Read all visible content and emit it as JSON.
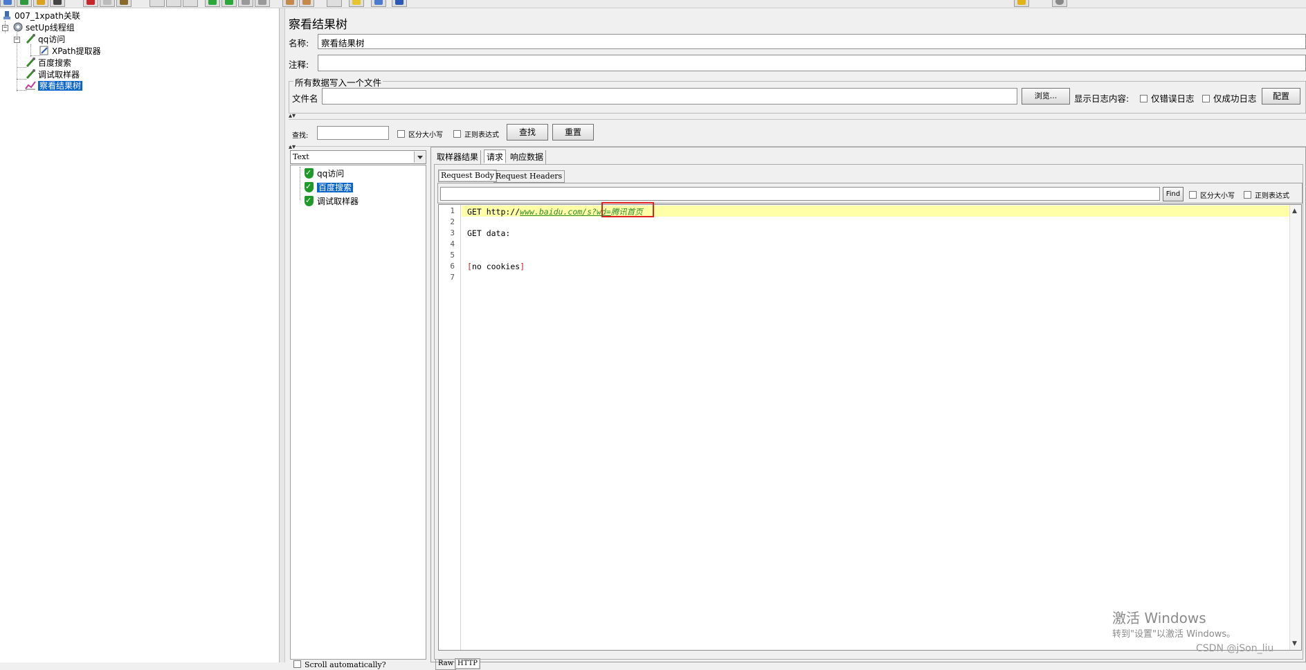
{
  "tree": {
    "items": [
      {
        "label": "007_1xpath关联"
      },
      {
        "label": "setUp线程组"
      },
      {
        "label": "qq访问"
      },
      {
        "label": "XPath提取器"
      },
      {
        "label": "百度搜索"
      },
      {
        "label": "调试取样器"
      },
      {
        "label": "察看结果树"
      }
    ]
  },
  "main": {
    "title": "察看结果树",
    "name_label": "名称:",
    "name_value": "察看结果树",
    "comment_label": "注释:",
    "comment_value": "",
    "file_group_title": "所有数据写入一个文件",
    "file_label": "文件名",
    "file_value": "",
    "browse_label": "浏览...",
    "log_label": "显示日志内容:",
    "errors_only_label": "仅错误日志",
    "success_only_label": "仅成功日志",
    "configure_label": "配置",
    "search_label": "查找:",
    "search_value": "",
    "case_sensitive_label": "区分大小写",
    "regex_label": "正则表达式",
    "find_button": "查找",
    "reset_button": "重置"
  },
  "results": {
    "renderer": "Text",
    "samples": [
      {
        "label": "qq访问"
      },
      {
        "label": "百度搜索"
      },
      {
        "label": "调试取样器"
      }
    ],
    "scroll_auto_label": "Scroll automatically?",
    "tabs": [
      "取样器结果",
      "请求",
      "响应数据"
    ],
    "subtabs": [
      "Request Body",
      "Request Headers"
    ],
    "find_button": "Find",
    "case_sensitive_label": "区分大小写",
    "regex_label": "正则表达式",
    "bottom_tabs": [
      "Raw",
      "HTTP"
    ]
  },
  "editor": {
    "line_numbers": [
      "1",
      "2",
      "3",
      "4",
      "5",
      "6",
      "7"
    ],
    "line1_prefix": "GET http://",
    "line1_url": "www.baidu.com/s?wd=",
    "line1_highlight": "腾讯首页",
    "line3": "GET data:",
    "line6_open": "[",
    "line6_text": "no cookies",
    "line6_close": "]"
  },
  "watermark": {
    "line1": "激活 Windows",
    "line2": "转到\"设置\"以激活 Windows。",
    "credit": "CSDN @jSon_liu"
  },
  "colors": {
    "selection": "#0a64c8",
    "highlight_box": "#e02020",
    "current_line": "#ffffa8",
    "success_shield": "#1f9a2a"
  }
}
